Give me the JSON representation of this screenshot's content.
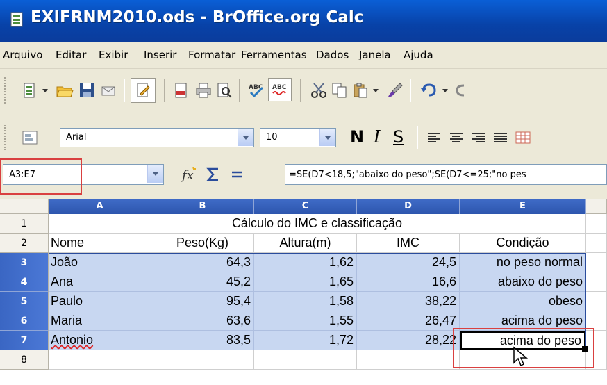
{
  "window": {
    "title": "EXIFRNM2010.ods - BrOffice.org Calc"
  },
  "menu": [
    {
      "label": "Arquivo"
    },
    {
      "label": "Editar"
    },
    {
      "label": "Exibir"
    },
    {
      "label": "Inserir"
    },
    {
      "label": "Formatar"
    },
    {
      "label": "Ferramentas"
    },
    {
      "label": "Dados"
    },
    {
      "label": "Janela"
    },
    {
      "label": "Ajuda"
    }
  ],
  "toolbar_icons": [
    "new-document-icon",
    "open-folder-icon",
    "save-icon",
    "email-icon",
    "edit-file-icon",
    "export-pdf-icon",
    "print-icon",
    "page-preview-icon",
    "spellcheck-icon",
    "autospellcheck-icon",
    "cut-icon",
    "copy-icon",
    "paste-icon",
    "format-paintbrush-icon",
    "undo-icon"
  ],
  "format": {
    "font_name": "Arial",
    "font_size": "10",
    "bold": "N",
    "italic": "I",
    "underline": "S"
  },
  "formula_bar": {
    "name_box": "A3:E7",
    "formula": "=SE(D7<18,5;\"abaixo do peso\";SE(D7<=25;\"no pes"
  },
  "sheet": {
    "columns": [
      "A",
      "B",
      "C",
      "D",
      "E"
    ],
    "rows": [
      "1",
      "2",
      "3",
      "4",
      "5",
      "6",
      "7",
      "8"
    ],
    "title_cell": "Cálculo do IMC e classificação",
    "headers": [
      "Nome",
      "Peso(Kg)",
      "Altura(m)",
      "IMC",
      "Condição"
    ],
    "data": [
      [
        "João",
        "64,3",
        "1,62",
        "24,5",
        "no peso normal"
      ],
      [
        "Ana",
        "45,2",
        "1,65",
        "16,6",
        "abaixo do peso"
      ],
      [
        "Paulo",
        "95,4",
        "1,58",
        "38,22",
        "obeso"
      ],
      [
        "Maria",
        "63,6",
        "1,55",
        "26,47",
        "acima do peso"
      ],
      [
        "Antonio",
        "83,5",
        "1,72",
        "28,22",
        "acima do peso"
      ]
    ]
  },
  "colors": {
    "selection": "#c8d7f1",
    "header_selected": "#3f6bc7",
    "annotation_box": "#d94040"
  }
}
